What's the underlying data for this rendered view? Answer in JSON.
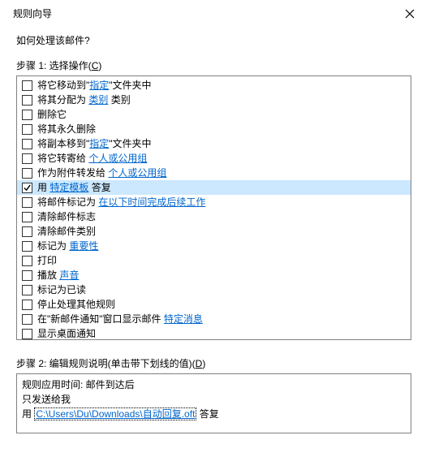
{
  "window": {
    "title": "规则向导"
  },
  "prompt": "如何处理该邮件?",
  "step1": {
    "label_prefix": "步骤 1: 选择操作(",
    "label_key": "C",
    "label_suffix": ")"
  },
  "actions": [
    {
      "checked": false,
      "selected": false,
      "parts": [
        {
          "t": "将它移动到\""
        },
        {
          "t": "指定",
          "link": true
        },
        {
          "t": "\"文件夹中"
        }
      ]
    },
    {
      "checked": false,
      "selected": false,
      "parts": [
        {
          "t": "将其分配为 "
        },
        {
          "t": "类别",
          "link": true
        },
        {
          "t": " 类别"
        }
      ]
    },
    {
      "checked": false,
      "selected": false,
      "parts": [
        {
          "t": "删除它"
        }
      ]
    },
    {
      "checked": false,
      "selected": false,
      "parts": [
        {
          "t": "将其永久删除"
        }
      ]
    },
    {
      "checked": false,
      "selected": false,
      "parts": [
        {
          "t": "将副本移到\""
        },
        {
          "t": "指定",
          "link": true
        },
        {
          "t": "\"文件夹中"
        }
      ]
    },
    {
      "checked": false,
      "selected": false,
      "parts": [
        {
          "t": "将它转寄给 "
        },
        {
          "t": "个人或公用组",
          "link": true
        }
      ]
    },
    {
      "checked": false,
      "selected": false,
      "parts": [
        {
          "t": "作为附件转发给 "
        },
        {
          "t": "个人或公用组",
          "link": true
        }
      ]
    },
    {
      "checked": true,
      "selected": true,
      "parts": [
        {
          "t": "用 "
        },
        {
          "t": "特定模板",
          "link": true
        },
        {
          "t": " 答复"
        }
      ]
    },
    {
      "checked": false,
      "selected": false,
      "parts": [
        {
          "t": "将邮件标记为 "
        },
        {
          "t": "在以下时间完成后续工作",
          "link": true
        }
      ]
    },
    {
      "checked": false,
      "selected": false,
      "parts": [
        {
          "t": "清除邮件标志"
        }
      ]
    },
    {
      "checked": false,
      "selected": false,
      "parts": [
        {
          "t": "清除邮件类别"
        }
      ]
    },
    {
      "checked": false,
      "selected": false,
      "parts": [
        {
          "t": "标记为 "
        },
        {
          "t": "重要性",
          "link": true
        }
      ]
    },
    {
      "checked": false,
      "selected": false,
      "parts": [
        {
          "t": "打印"
        }
      ]
    },
    {
      "checked": false,
      "selected": false,
      "parts": [
        {
          "t": "播放 "
        },
        {
          "t": "声音",
          "link": true
        }
      ]
    },
    {
      "checked": false,
      "selected": false,
      "parts": [
        {
          "t": "标记为已读"
        }
      ]
    },
    {
      "checked": false,
      "selected": false,
      "parts": [
        {
          "t": "停止处理其他规则"
        }
      ]
    },
    {
      "checked": false,
      "selected": false,
      "parts": [
        {
          "t": "在\"新邮件通知\"窗口显示邮件 "
        },
        {
          "t": "特定消息",
          "link": true
        }
      ]
    },
    {
      "checked": false,
      "selected": false,
      "parts": [
        {
          "t": "显示桌面通知"
        }
      ]
    }
  ],
  "step2": {
    "label_prefix": "步骤 2: 编辑规则说明(单击带下划线的值)(",
    "label_key": "D",
    "label_suffix": ")"
  },
  "description": {
    "lines": [
      {
        "parts": [
          {
            "t": "规则应用时间: 邮件到达后"
          }
        ]
      },
      {
        "parts": [
          {
            "t": "只发送给我"
          }
        ]
      },
      {
        "parts": [
          {
            "t": "用 "
          },
          {
            "t": "C:\\Users\\Du\\Downloads\\自动回复.oft",
            "dotted": true
          },
          {
            "t": " 答复"
          }
        ]
      }
    ]
  }
}
